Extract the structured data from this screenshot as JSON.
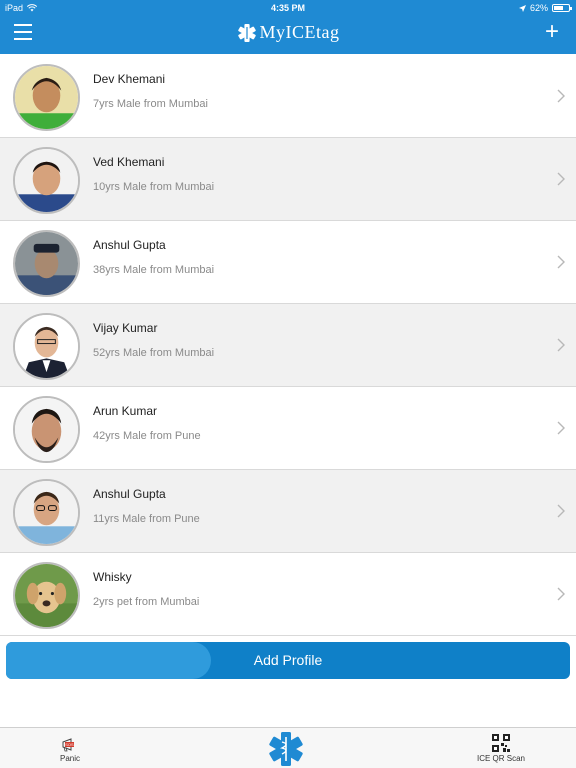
{
  "status_bar": {
    "carrier": "iPad",
    "time": "4:35 PM",
    "battery": "62%",
    "battery_level": 0.62
  },
  "nav": {
    "logo_text": "MyICEtag",
    "menu_icon": "hamburger-menu-icon",
    "add_icon": "plus-icon"
  },
  "profiles": [
    {
      "name": "Dev Khemani",
      "detail": "7yrs Male from Mumbai"
    },
    {
      "name": "Ved Khemani",
      "detail": "10yrs Male from Mumbai"
    },
    {
      "name": "Anshul Gupta",
      "detail": "38yrs Male from Mumbai"
    },
    {
      "name": "Vijay Kumar",
      "detail": "52yrs Male from Mumbai"
    },
    {
      "name": "Arun Kumar",
      "detail": "42yrs Male from Pune"
    },
    {
      "name": "Anshul Gupta",
      "detail": "11yrs Male from Pune"
    },
    {
      "name": "Whisky",
      "detail": "2yrs pet from Mumbai"
    }
  ],
  "add_profile_label": "Add Profile",
  "tabbar": {
    "panic_label": "Panic",
    "scan_label": "ICE QR Scan"
  },
  "colors": {
    "primary": "#1f8ad3",
    "button": "#0f80c8",
    "alt_row": "#f1f1f1"
  }
}
